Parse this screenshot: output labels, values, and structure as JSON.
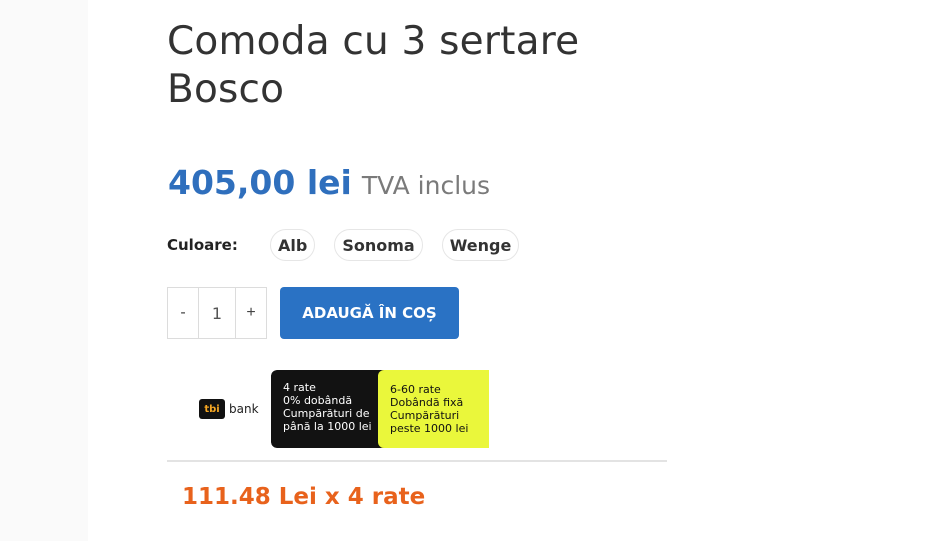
{
  "product": {
    "title": "Comoda cu 3 sertare Bosco",
    "price": "405,00 lei",
    "tax_note": "TVA inclus"
  },
  "color_selector": {
    "label": "Culoare:",
    "options": [
      "Alb",
      "Sonoma",
      "Wenge"
    ]
  },
  "quantity": {
    "minus": "-",
    "value": "1",
    "plus": "+"
  },
  "cart": {
    "add_label": "ADAUGĂ ÎN COȘ"
  },
  "tbi": {
    "logo_mark": "tbi",
    "logo_text": "bank",
    "offer_left": [
      "4 rate",
      "0% dobândă",
      "Cumpărături de",
      "până la 1000 lei"
    ],
    "offer_right": [
      "6-60 rate",
      "Dobândă fixă",
      "Cumpărături",
      "peste 1000 lei"
    ]
  },
  "installment_text": "111.48 Lei x 4 rate",
  "colors": {
    "price": "#2f6fbd",
    "button": "#2a72c4",
    "installment": "#e8621c",
    "tbi_yellow": "#eaf73b"
  }
}
